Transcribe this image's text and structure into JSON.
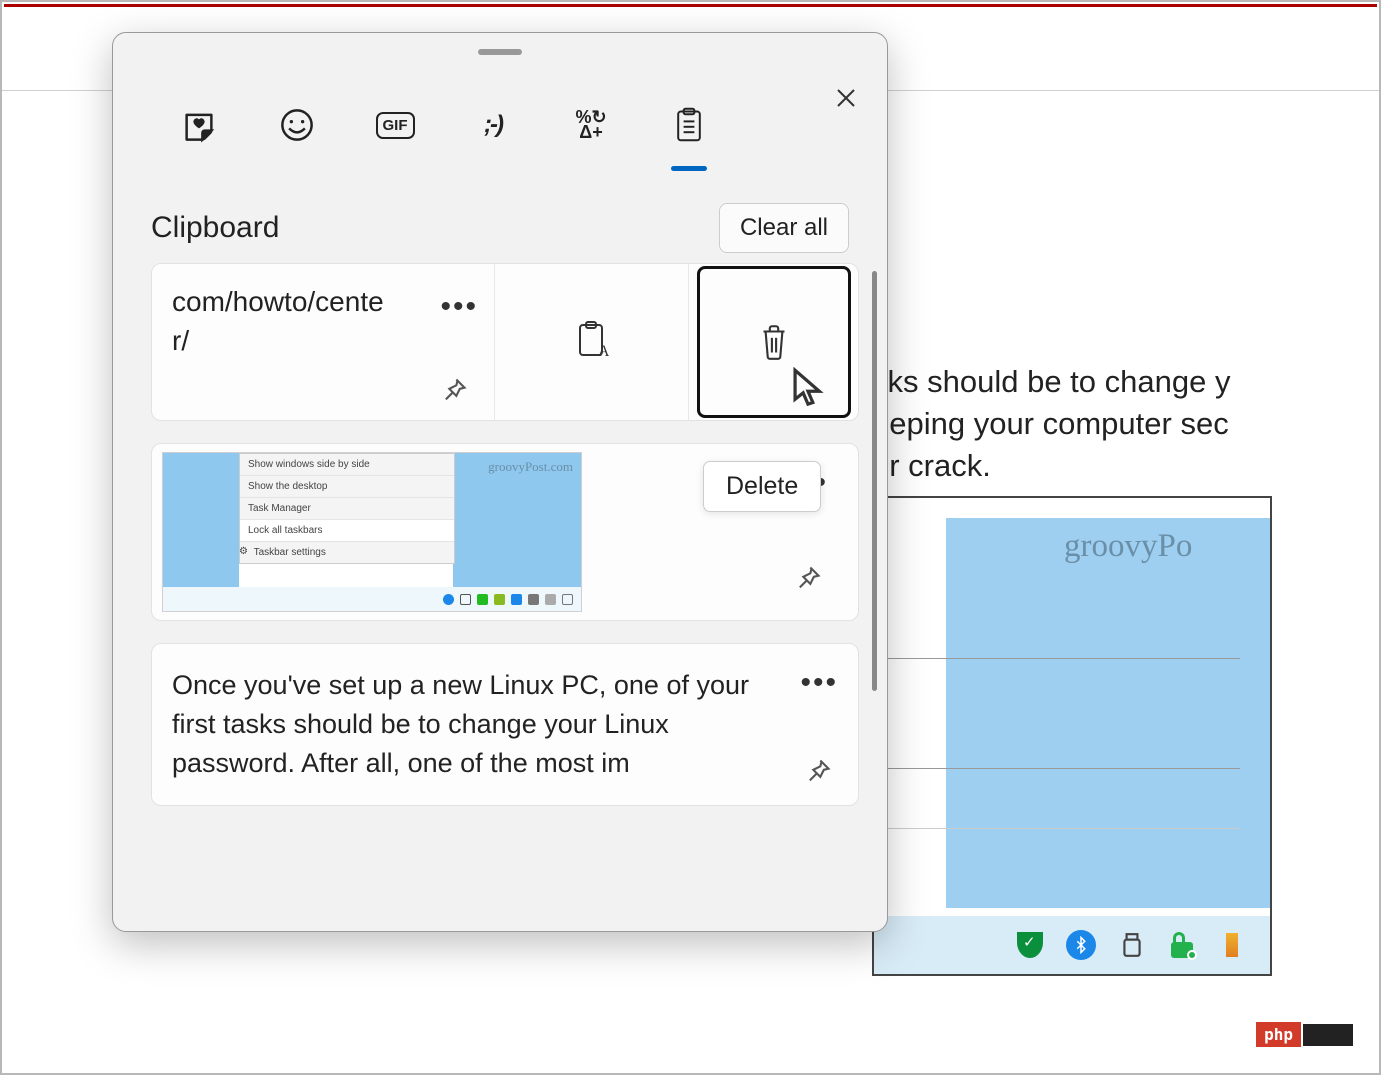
{
  "background": {
    "text_lines": [
      "sks should be to change y",
      "eeping your computer sec",
      " or crack."
    ],
    "watermark": "groovyPo"
  },
  "panel": {
    "tabs": {
      "stickers": "stickers-icon",
      "emoji": "emoji-icon",
      "gif_label": "GIF",
      "kaomoji": ";-)",
      "symbols_top": "%↻",
      "symbols_bottom": "Δ+",
      "clipboard": "clipboard-icon"
    },
    "section_title": "Clipboard",
    "clear_all_label": "Clear all",
    "tooltip_delete": "Delete",
    "items": [
      {
        "type": "text",
        "text": "com/howto/center/",
        "text_line1": "com/howto/cente",
        "text_line2": "r/"
      },
      {
        "type": "image",
        "watermark": "groovyPost.com",
        "menu": [
          "Show windows side by side",
          "Show the desktop",
          "Task Manager",
          "Lock all taskbars",
          "Taskbar settings"
        ]
      },
      {
        "type": "text",
        "text": "Once you've set up a new Linux PC, one of your first tasks should be to change your Linux password. After all, one of the most im"
      }
    ]
  },
  "watermark": {
    "php": "php"
  }
}
